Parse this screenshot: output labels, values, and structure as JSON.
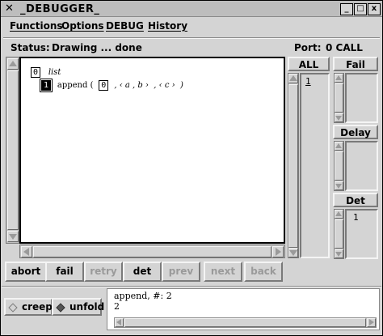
{
  "window": {
    "title": "_DEBUGGER_",
    "buttons": {
      "minimize": "_",
      "maximize": "□",
      "close": "x"
    }
  },
  "menu": [
    {
      "label": "Functions",
      "key": "F"
    },
    {
      "label": "Options",
      "key": "O"
    },
    {
      "label": "DEBUG",
      "key": "D"
    },
    {
      "label": "History",
      "key": "H"
    }
  ],
  "status": {
    "status_label": "Status:",
    "status_value": "Drawing ... done",
    "port_label": "Port:",
    "port_value": "0 CALL"
  },
  "view": {
    "root_number": "0",
    "root_label": "list",
    "goal_number": "1",
    "goal_prefix": "append (",
    "goal_arg_number": "0",
    "goal_rest": " , ‹ a , b ›  , ‹ c ›  )"
  },
  "panels": {
    "all_label": "ALL",
    "all_items": [
      "1"
    ],
    "fail_label": "Fail",
    "delay_label": "Delay",
    "det_label": "Det",
    "det_items": [
      "1"
    ]
  },
  "buttons": [
    {
      "label": "abort",
      "enabled": true
    },
    {
      "label": "fail",
      "enabled": true
    },
    {
      "label": "retry",
      "enabled": false
    },
    {
      "label": "det",
      "enabled": true
    },
    {
      "label": "prev",
      "enabled": false
    },
    {
      "label": "next",
      "enabled": false
    },
    {
      "label": "back",
      "enabled": false
    }
  ],
  "mode": {
    "creep_label": "creep",
    "creep_selected": false,
    "unfold_label": "unfold",
    "unfold_selected": true
  },
  "output": {
    "line1": "append, #: 2",
    "line2": "2"
  }
}
